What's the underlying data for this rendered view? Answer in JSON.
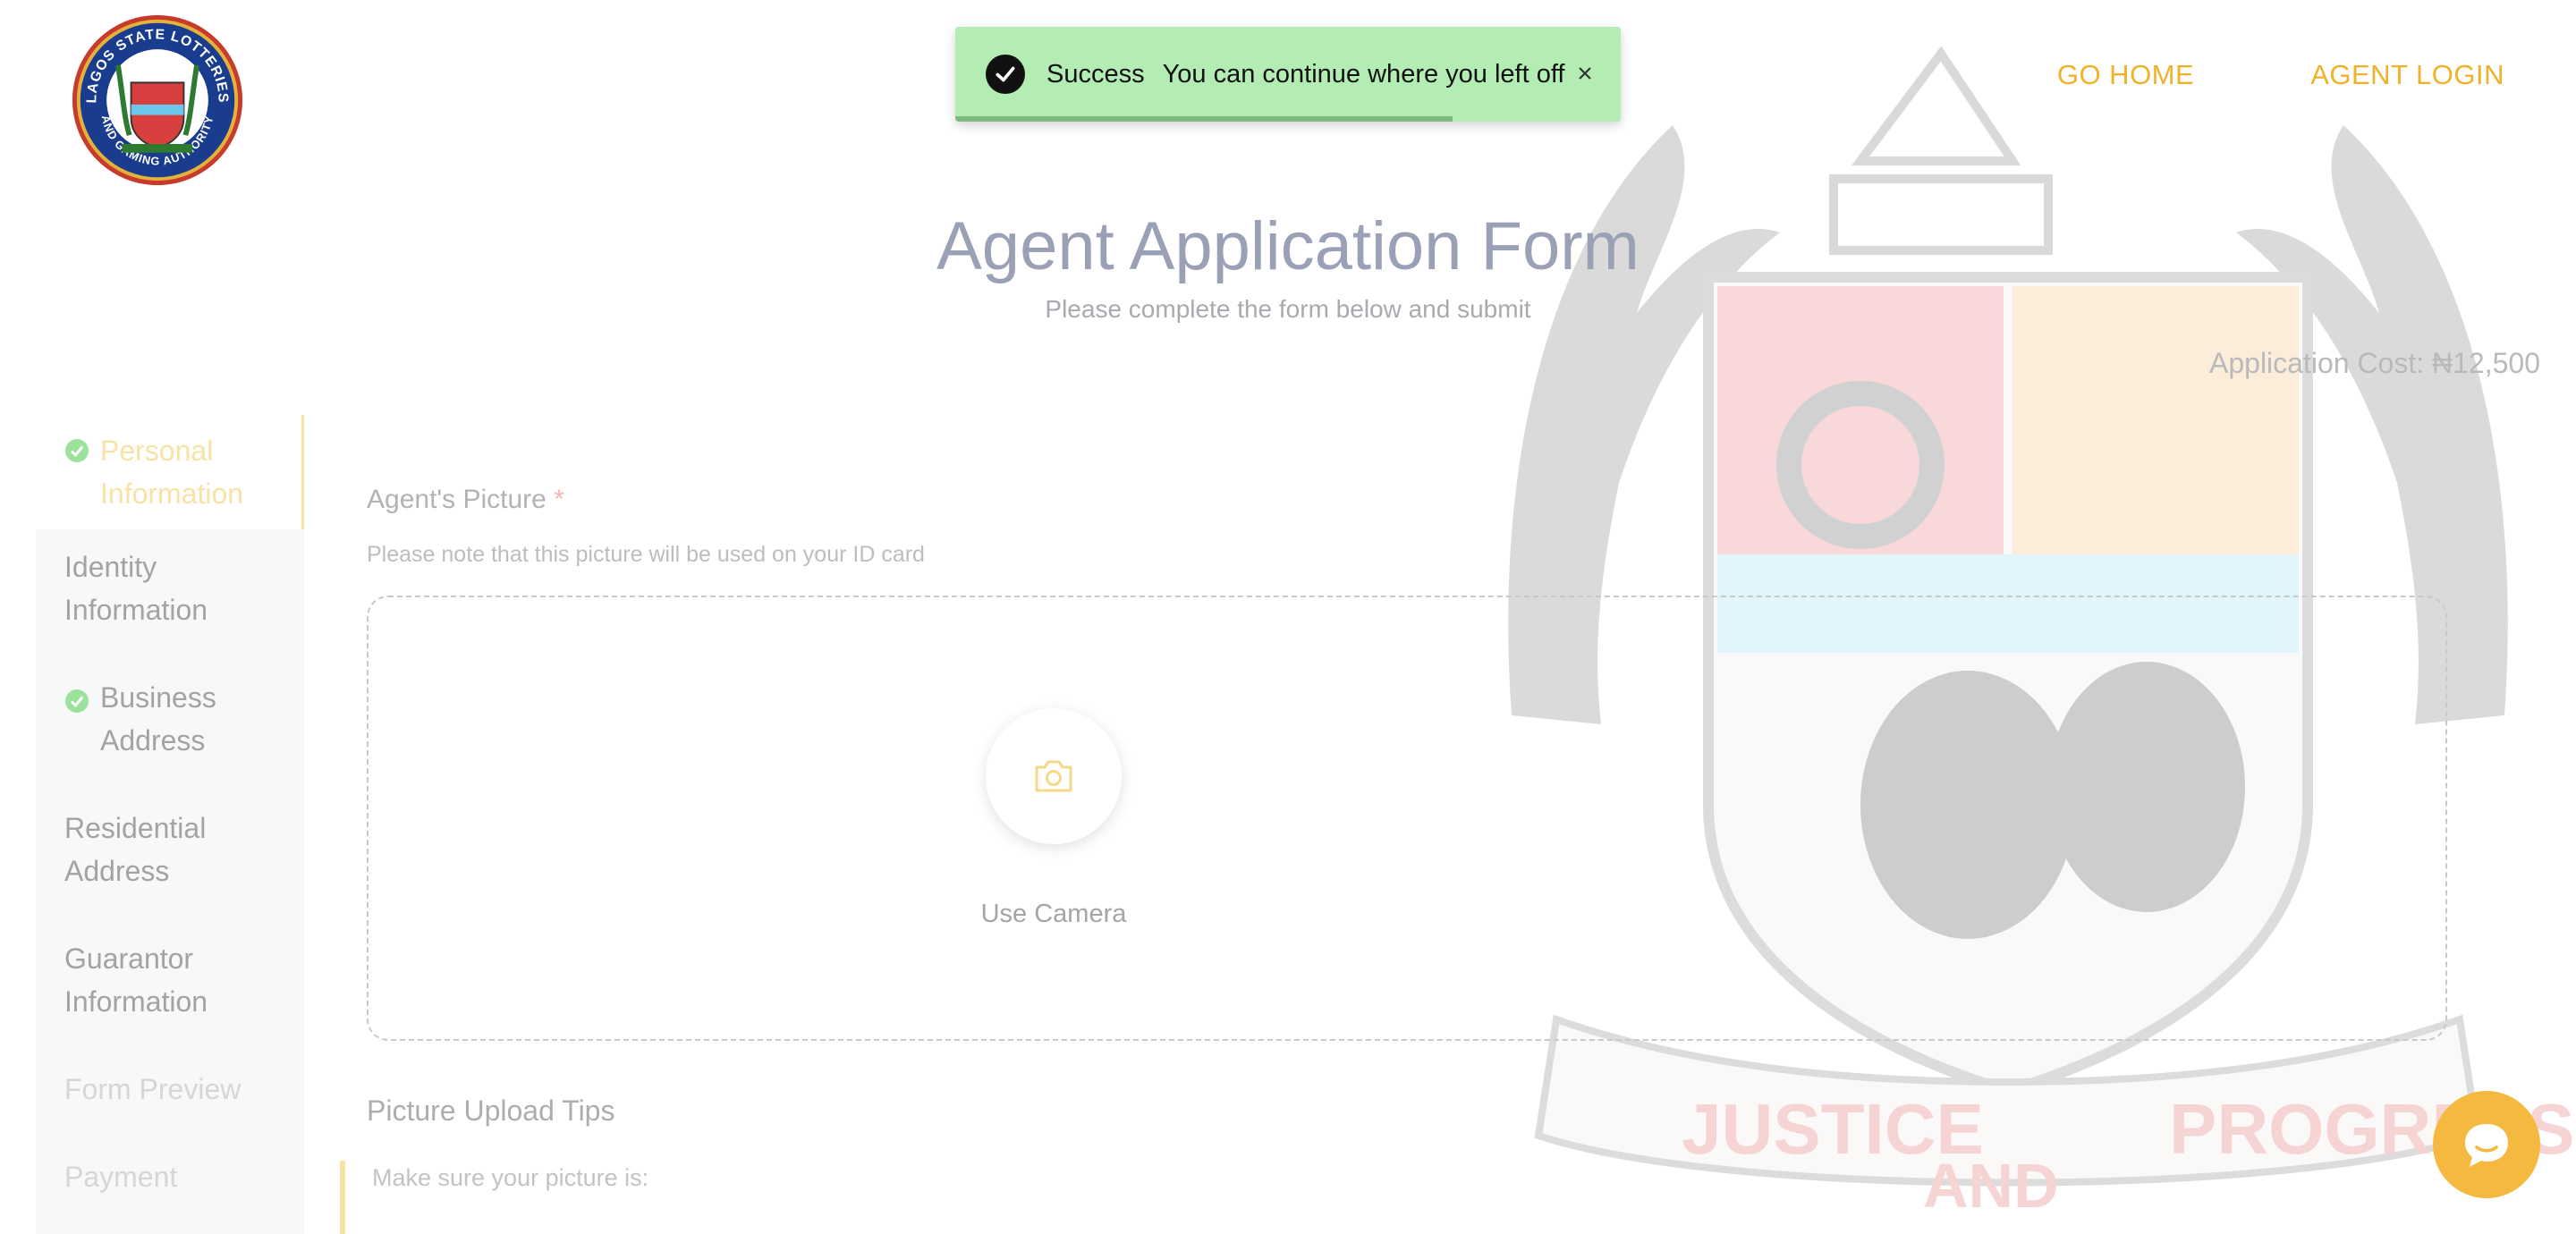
{
  "logo": {
    "ring_top": "LAGOS STATE LOTTERIES",
    "ring_bottom": "AND GAMING AUTHORITY"
  },
  "nav": {
    "home_label": "GO HOME",
    "agent_login_label": "AGENT LOGIN"
  },
  "toast": {
    "title": "Success",
    "message": "You can continue where you left off",
    "color": "#b3edb3"
  },
  "page": {
    "title": "Agent Application Form",
    "subtitle": "Please complete the form below and submit",
    "cost": "Application Cost: ₦12,500"
  },
  "steps": [
    {
      "label1": "Personal",
      "label2": "Information",
      "state": "active",
      "complete": true
    },
    {
      "label1": "Identity",
      "label2": "Information",
      "state": "normal",
      "complete": false
    },
    {
      "label1": "Business",
      "label2": "Address",
      "state": "normal",
      "complete": true
    },
    {
      "label1": "Residential",
      "label2": "Address",
      "state": "normal",
      "complete": false
    },
    {
      "label1": "Guarantor",
      "label2": "Information",
      "state": "normal",
      "complete": false
    },
    {
      "label1": "Form Preview",
      "state": "disabled",
      "complete": false
    },
    {
      "label1": "Payment",
      "state": "disabled",
      "complete": false
    }
  ],
  "form": {
    "picture_label": "Agent's Picture",
    "required_mark": "*",
    "picture_note": "Please note that this picture will be used on your ID card",
    "camera_label": "Use Camera",
    "tips_title": "Picture Upload Tips",
    "tips_intro": "Make sure your picture is:"
  },
  "watermark": {
    "motto_left": "JUSTICE",
    "motto_mid": "AND",
    "motto_right": "PROGRESS"
  },
  "colors": {
    "accent": "#f0b22b",
    "chat": "#f5b940"
  }
}
